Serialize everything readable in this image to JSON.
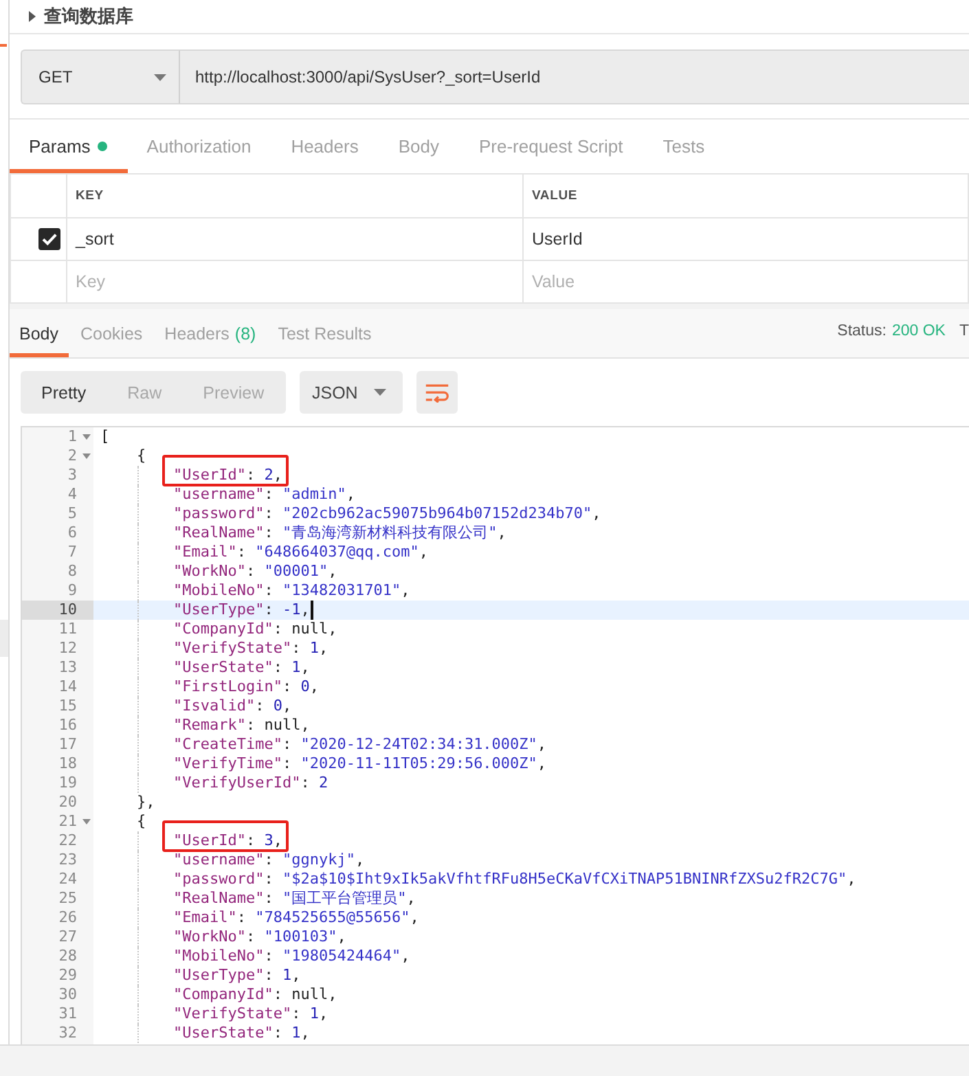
{
  "request": {
    "title": "查询数据库",
    "method": "GET",
    "url": "http://localhost:3000/api/SysUser?_sort=UserId"
  },
  "request_tabs": [
    {
      "label": "Params",
      "selected": true,
      "indicator": true
    },
    {
      "label": "Authorization",
      "selected": false,
      "indicator": false
    },
    {
      "label": "Headers",
      "selected": false,
      "indicator": false
    },
    {
      "label": "Body",
      "selected": false,
      "indicator": false
    },
    {
      "label": "Pre-request Script",
      "selected": false,
      "indicator": false
    },
    {
      "label": "Tests",
      "selected": false,
      "indicator": false
    }
  ],
  "params": {
    "columns": [
      "KEY",
      "VALUE"
    ],
    "rows": [
      {
        "checked": true,
        "key": "_sort",
        "value": "UserId"
      }
    ],
    "new_row": {
      "key": {
        "placeholder": "Key"
      },
      "value": {
        "placeholder": "Value"
      }
    }
  },
  "response": {
    "tabs": [
      {
        "label": "Body",
        "selected": true
      },
      {
        "label": "Cookies",
        "selected": false
      },
      {
        "label": "Headers",
        "count": "(8)",
        "selected": false
      },
      {
        "label": "Test Results",
        "selected": false
      }
    ],
    "status": {
      "label": "Status:",
      "value": "200 OK"
    },
    "time_label": "T",
    "views": [
      {
        "label": "Pretty",
        "selected": true
      },
      {
        "label": "Raw",
        "selected": false
      },
      {
        "label": "Preview",
        "selected": false
      }
    ],
    "format": "JSON",
    "editor": {
      "lines": [
        {
          "number": "1",
          "active": false,
          "boxed": false,
          "value": "[",
          "kind": "punct",
          "children": [
            {
              "number": "2",
              "active": false,
              "boxed": false,
              "value": "{",
              "kind": "punct",
              "children": [
                {
                  "number": "3",
                  "active": false,
                  "boxed": true,
                  "key": "\"UserId\"",
                  "sep": ": ",
                  "value": "2",
                  "kind": "number",
                  "end": ","
                },
                {
                  "number": "4",
                  "active": false,
                  "boxed": false,
                  "key": "\"username\"",
                  "sep": ": ",
                  "value": "\"admin\"",
                  "kind": "string",
                  "end": ","
                },
                {
                  "number": "5",
                  "active": false,
                  "boxed": false,
                  "key": "\"password\"",
                  "sep": ": ",
                  "value": "\"202cb962ac59075b964b07152d234b70\"",
                  "kind": "string",
                  "end": ","
                },
                {
                  "number": "6",
                  "active": false,
                  "boxed": false,
                  "key": "\"RealName\"",
                  "sep": ": ",
                  "value": "\"青岛海湾新材料科技有限公司\"",
                  "kind": "string",
                  "end": ","
                },
                {
                  "number": "7",
                  "active": false,
                  "boxed": false,
                  "key": "\"Email\"",
                  "sep": ": ",
                  "value": "\"648664037@qq.com\"",
                  "kind": "string",
                  "end": ","
                },
                {
                  "number": "8",
                  "active": false,
                  "boxed": false,
                  "key": "\"WorkNo\"",
                  "sep": ": ",
                  "value": "\"00001\"",
                  "kind": "string",
                  "end": ","
                },
                {
                  "number": "9",
                  "active": false,
                  "boxed": false,
                  "key": "\"MobileNo\"",
                  "sep": ": ",
                  "value": "\"13482031701\"",
                  "kind": "string",
                  "end": ","
                },
                {
                  "number": "10",
                  "active": true,
                  "boxed": false,
                  "key": "\"UserType\"",
                  "sep": ": ",
                  "value": "-1",
                  "kind": "number",
                  "end": ","
                },
                {
                  "number": "11",
                  "active": false,
                  "boxed": false,
                  "key": "\"CompanyId\"",
                  "sep": ": ",
                  "value": "null",
                  "kind": "literal",
                  "end": ","
                },
                {
                  "number": "12",
                  "active": false,
                  "boxed": false,
                  "key": "\"VerifyState\"",
                  "sep": ": ",
                  "value": "1",
                  "kind": "number",
                  "end": ","
                },
                {
                  "number": "13",
                  "active": false,
                  "boxed": false,
                  "key": "\"UserState\"",
                  "sep": ": ",
                  "value": "1",
                  "kind": "number",
                  "end": ","
                },
                {
                  "number": "14",
                  "active": false,
                  "boxed": false,
                  "key": "\"FirstLogin\"",
                  "sep": ": ",
                  "value": "0",
                  "kind": "number",
                  "end": ","
                },
                {
                  "number": "15",
                  "active": false,
                  "boxed": false,
                  "key": "\"Isvalid\"",
                  "sep": ": ",
                  "value": "0",
                  "kind": "number",
                  "end": ","
                },
                {
                  "number": "16",
                  "active": false,
                  "boxed": false,
                  "key": "\"Remark\"",
                  "sep": ": ",
                  "value": "null",
                  "kind": "literal",
                  "end": ","
                },
                {
                  "number": "17",
                  "active": false,
                  "boxed": false,
                  "key": "\"CreateTime\"",
                  "sep": ": ",
                  "value": "\"2020-12-24T02:34:31.000Z\"",
                  "kind": "string",
                  "end": ","
                },
                {
                  "number": "18",
                  "active": false,
                  "boxed": false,
                  "key": "\"VerifyTime\"",
                  "sep": ": ",
                  "value": "\"2020-11-11T05:29:56.000Z\"",
                  "kind": "string",
                  "end": ","
                },
                {
                  "number": "19",
                  "active": false,
                  "boxed": false,
                  "key": "\"VerifyUserId\"",
                  "sep": ": ",
                  "value": "2",
                  "kind": "number"
                }
              ]
            },
            {
              "number": "20",
              "active": false,
              "boxed": false,
              "value": "},",
              "kind": "punct"
            },
            {
              "number": "21",
              "active": false,
              "boxed": false,
              "value": "{",
              "kind": "punct",
              "children": [
                {
                  "number": "22",
                  "active": false,
                  "boxed": true,
                  "key": "\"UserId\"",
                  "sep": ": ",
                  "value": "3",
                  "kind": "number",
                  "end": ","
                },
                {
                  "number": "23",
                  "active": false,
                  "boxed": false,
                  "key": "\"username\"",
                  "sep": ": ",
                  "value": "\"ggnykj\"",
                  "kind": "string",
                  "end": ","
                },
                {
                  "number": "24",
                  "active": false,
                  "boxed": false,
                  "key": "\"password\"",
                  "sep": ": ",
                  "value": "\"$2a$10$Iht9xIk5akVfhtfRFu8H5eCKaVfCXiTNAP51BNINRfZXSu2fR2C7G\"",
                  "kind": "string",
                  "end": ","
                },
                {
                  "number": "25",
                  "active": false,
                  "boxed": false,
                  "key": "\"RealName\"",
                  "sep": ": ",
                  "value": "\"国工平台管理员\"",
                  "kind": "string",
                  "end": ","
                },
                {
                  "number": "26",
                  "active": false,
                  "boxed": false,
                  "key": "\"Email\"",
                  "sep": ": ",
                  "value": "\"784525655@55656\"",
                  "kind": "string",
                  "end": ","
                },
                {
                  "number": "27",
                  "active": false,
                  "boxed": false,
                  "key": "\"WorkNo\"",
                  "sep": ": ",
                  "value": "\"100103\"",
                  "kind": "string",
                  "end": ","
                },
                {
                  "number": "28",
                  "active": false,
                  "boxed": false,
                  "key": "\"MobileNo\"",
                  "sep": ": ",
                  "value": "\"19805424464\"",
                  "kind": "string",
                  "end": ","
                },
                {
                  "number": "29",
                  "active": false,
                  "boxed": false,
                  "key": "\"UserType\"",
                  "sep": ": ",
                  "value": "1",
                  "kind": "number",
                  "end": ","
                },
                {
                  "number": "30",
                  "active": false,
                  "boxed": false,
                  "key": "\"CompanyId\"",
                  "sep": ": ",
                  "value": "null",
                  "kind": "literal",
                  "end": ","
                },
                {
                  "number": "31",
                  "active": false,
                  "boxed": false,
                  "key": "\"VerifyState\"",
                  "sep": ": ",
                  "value": "1",
                  "kind": "number",
                  "end": ","
                },
                {
                  "number": "32",
                  "active": false,
                  "boxed": false,
                  "key": "\"UserState\"",
                  "sep": ": ",
                  "value": "1",
                  "kind": "number",
                  "end": ","
                }
              ]
            }
          ]
        }
      ]
    }
  }
}
